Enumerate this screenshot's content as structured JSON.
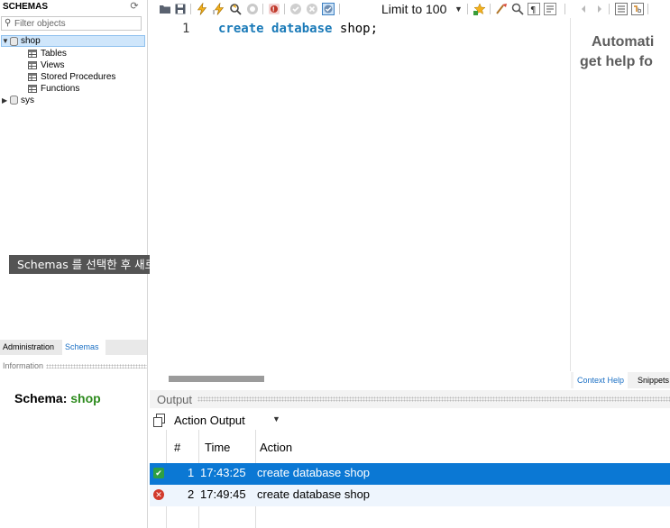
{
  "sidebar": {
    "title": "SCHEMAS",
    "filter_placeholder": "Filter objects",
    "tree": {
      "shop": {
        "label": "shop",
        "children": [
          "Tables",
          "Views",
          "Stored Procedures",
          "Functions"
        ]
      },
      "sys": {
        "label": "sys"
      }
    },
    "hint": "Schemas 를 선택한 후 새로 고침 클릭",
    "tabs": [
      "Administration",
      "Schemas"
    ],
    "info_title": "Information",
    "schema_info": {
      "prefix": "Schema:",
      "name": "shop"
    }
  },
  "toolbar": {
    "limit_label": "Limit to 100"
  },
  "editor": {
    "line_number": "1",
    "code": {
      "kw1": "create",
      "kw2": "database",
      "ident": "shop;"
    }
  },
  "help_panel": {
    "line1": "Automati",
    "line2": "get help fo",
    "tabs": [
      "Context Help",
      "Snippets"
    ]
  },
  "output": {
    "title": "Output",
    "selector": "Action Output",
    "columns": [
      "#",
      "Time",
      "Action"
    ],
    "rows": [
      {
        "num": "1",
        "time": "17:43:25",
        "action": "create database shop",
        "status": "success"
      },
      {
        "num": "2",
        "time": "17:49:45",
        "action": "create database shop",
        "status": "error"
      }
    ]
  },
  "colors": {
    "accent": "#0b78d4",
    "keyword": "#1a7ab8",
    "schema_name": "#2e8b1e",
    "success": "#2ea043",
    "error": "#d23a2c"
  }
}
